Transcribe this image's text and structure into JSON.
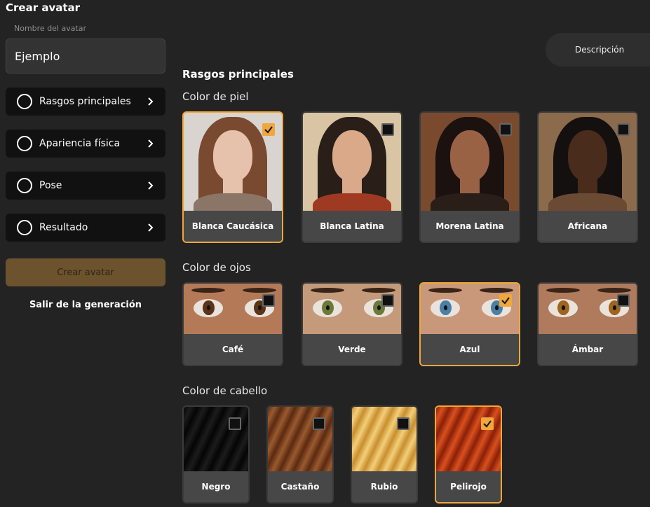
{
  "sidebar": {
    "title": "Crear avatar",
    "name_label": "Nombre del avatar",
    "name_value": "Ejemplo",
    "steps": [
      {
        "label": "Rasgos principales"
      },
      {
        "label": "Apariencia física"
      },
      {
        "label": "Pose"
      },
      {
        "label": "Resultado"
      }
    ],
    "create_label": "Crear avatar",
    "exit_label": "Salir de la generación"
  },
  "main": {
    "description_tab": "Descripción",
    "section_title": "Rasgos principales",
    "skin": {
      "title": "Color de piel",
      "options": [
        {
          "label": "Blanca Caucásica",
          "selected": true,
          "skin": "#e6c2ad",
          "hair": "#7a4a30",
          "bg": "#d9d4cf",
          "shirt": "#8a7566"
        },
        {
          "label": "Blanca Latina",
          "selected": false,
          "skin": "#d9a98a",
          "hair": "#2a1e18",
          "bg": "#d9c4a3",
          "shirt": "#9e3a22"
        },
        {
          "label": "Morena Latina",
          "selected": false,
          "skin": "#9a6245",
          "hair": "#1b1210",
          "bg": "#7a4a2e",
          "shirt": "#2a1e18"
        },
        {
          "label": "Africana",
          "selected": false,
          "skin": "#4a2c1d",
          "hair": "#141010",
          "bg": "#8c6a4c",
          "shirt": "#6b4a34"
        }
      ]
    },
    "eyes": {
      "title": "Color de ojos",
      "options": [
        {
          "label": "Café",
          "selected": false,
          "iris": "#5a3318",
          "skin": "#b47a58"
        },
        {
          "label": "Verde",
          "selected": false,
          "iris": "#6b7a3a",
          "skin": "#c49a7a"
        },
        {
          "label": "Azul",
          "selected": true,
          "iris": "#4a7fa6",
          "skin": "#c9987a"
        },
        {
          "label": "Ámbar",
          "selected": false,
          "iris": "#a0641c",
          "skin": "#b07a5c"
        }
      ]
    },
    "hair": {
      "title": "Color de cabello",
      "options": [
        {
          "label": "Negro",
          "selected": false,
          "c1": "#050505",
          "c2": "#1c1c1c"
        },
        {
          "label": "Castaño",
          "selected": false,
          "c1": "#5a2a12",
          "c2": "#9a5a2e"
        },
        {
          "label": "Rubio",
          "selected": false,
          "c1": "#c98e2e",
          "c2": "#f2cf7a"
        },
        {
          "label": "Pelirojo",
          "selected": true,
          "c1": "#8a2008",
          "c2": "#d9501e"
        }
      ]
    },
    "colors": {
      "accent": "#f0a73b",
      "create_button": "#6c532e"
    }
  }
}
